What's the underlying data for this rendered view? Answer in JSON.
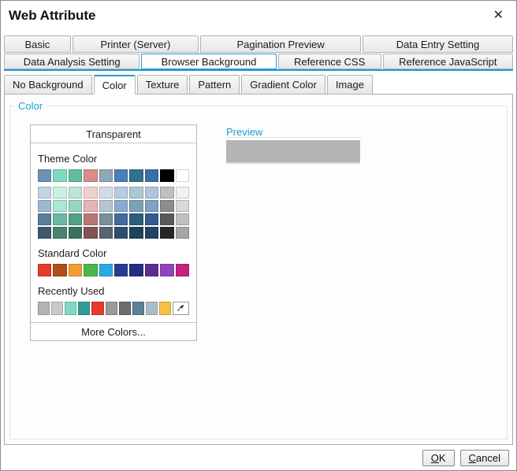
{
  "colors": {
    "accent": "#1E9BD7"
  },
  "dialog": {
    "title": "Web Attribute",
    "close_icon": "✕"
  },
  "tabs_row1": [
    {
      "label": "Basic"
    },
    {
      "label": "Printer (Server)"
    },
    {
      "label": "Pagination Preview"
    },
    {
      "label": "Data Entry Setting"
    }
  ],
  "tabs_row2": [
    {
      "label": "Data Analysis Setting"
    },
    {
      "label": "Browser Background",
      "active": true
    },
    {
      "label": "Reference CSS"
    },
    {
      "label": "Reference JavaScript"
    }
  ],
  "subtabs": [
    {
      "label": "No Background"
    },
    {
      "label": "Color",
      "active": true
    },
    {
      "label": "Texture"
    },
    {
      "label": "Pattern"
    },
    {
      "label": "Gradient Color"
    },
    {
      "label": "Image"
    }
  ],
  "color_section": {
    "legend": "Color",
    "transparent_button": "Transparent",
    "theme_label": "Theme Color",
    "standard_label": "Standard Color",
    "recent_label": "Recently Used",
    "more_colors_button": "More Colors...",
    "theme_base": [
      "#6A93B5",
      "#7FD9C2",
      "#5FBE9B",
      "#D98C8C",
      "#8FA8B8",
      "#4A7EBB",
      "#31708F",
      "#3A6FA8",
      "#000000",
      "#FFFFFF"
    ],
    "theme_variants": [
      [
        "#C3D4E1",
        "#CCF0E7",
        "#BFE5D7",
        "#F0D1D1",
        "#D2DCE3",
        "#B7CBE4",
        "#ACC6D2",
        "#B0C5DC",
        "#BFBFBF",
        "#F2F2F2"
      ],
      [
        "#9EB9CF",
        "#ACE6D7",
        "#97D5BE",
        "#E6B4B4",
        "#B6C6D1",
        "#89ABD3",
        "#79A2B6",
        "#7FA1C6",
        "#8C8C8C",
        "#D9D9D9"
      ],
      [
        "#5A7D9A",
        "#6CB8A5",
        "#51A284",
        "#B87777",
        "#7A8F9C",
        "#3F6B9F",
        "#2A5F7A",
        "#315E8F",
        "#595959",
        "#BFBFBF"
      ],
      [
        "#40586D",
        "#4C8274",
        "#39725D",
        "#825454",
        "#56656E",
        "#2C4C70",
        "#1D4356",
        "#234365",
        "#262626",
        "#A6A6A6"
      ]
    ],
    "standard": [
      "#E8392D",
      "#B04F17",
      "#F0A030",
      "#4CB648",
      "#29ABE2",
      "#2A3A8F",
      "#252E80",
      "#5C2D91",
      "#9345C0",
      "#C4237E"
    ],
    "recent": [
      "#B3B3B3",
      "#C9C9C9",
      "#7FD9C2",
      "#2E9E96",
      "#E8392D",
      "#9B9B9B",
      "#6E6E6E",
      "#5F7F95",
      "#A9BDCB",
      "#F5C142"
    ]
  },
  "preview": {
    "legend": "Preview",
    "swatch_color": "#B5B5B5"
  },
  "footer": {
    "ok_label": "OK",
    "cancel_label": "Cancel"
  }
}
